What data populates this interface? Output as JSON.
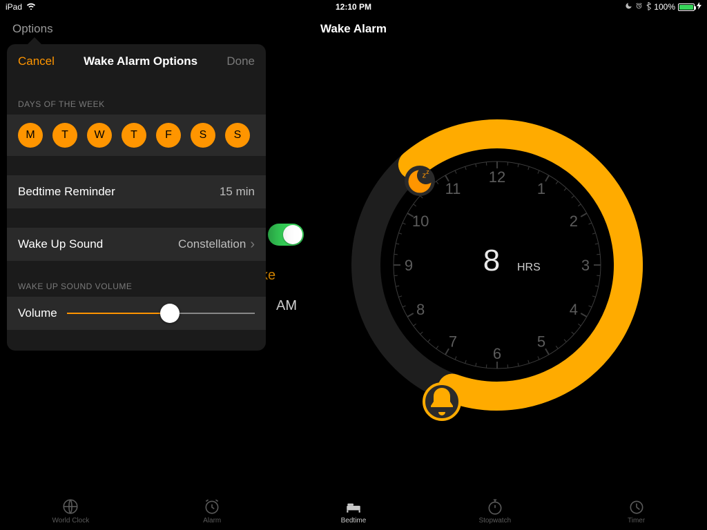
{
  "status": {
    "device": "iPad",
    "time": "12:10 PM",
    "battery_pct": "100%"
  },
  "nav": {
    "left": "Options",
    "title": "Wake Alarm"
  },
  "popover": {
    "cancel": "Cancel",
    "title": "Wake Alarm Options",
    "done": "Done",
    "days_label": "DAYS OF THE WEEK",
    "days": [
      "M",
      "T",
      "W",
      "T",
      "F",
      "S",
      "S"
    ],
    "bedtime_reminder_label": "Bedtime Reminder",
    "bedtime_reminder_value": "15 min",
    "wake_sound_label": "Wake Up Sound",
    "wake_sound_value": "Constellation",
    "volume_section_label": "WAKE UP SOUND VOLUME",
    "volume_label": "Volume",
    "volume_pct": 55
  },
  "background": {
    "wake_fragment": "ke",
    "am_fragment": "AM"
  },
  "dial": {
    "hours": "8",
    "hours_unit": "HRS",
    "numbers": [
      "12",
      "1",
      "2",
      "3",
      "4",
      "5",
      "6",
      "7",
      "8",
      "9",
      "10",
      "11"
    ],
    "arc_start_deg": 320,
    "arc_end_deg": 200
  },
  "tabs": {
    "items": [
      {
        "label": "World Clock"
      },
      {
        "label": "Alarm"
      },
      {
        "label": "Bedtime"
      },
      {
        "label": "Stopwatch"
      },
      {
        "label": "Timer"
      }
    ],
    "active_index": 2
  },
  "colors": {
    "accent": "#ff9500",
    "arc": "#ffab00",
    "green": "#37d55a"
  }
}
